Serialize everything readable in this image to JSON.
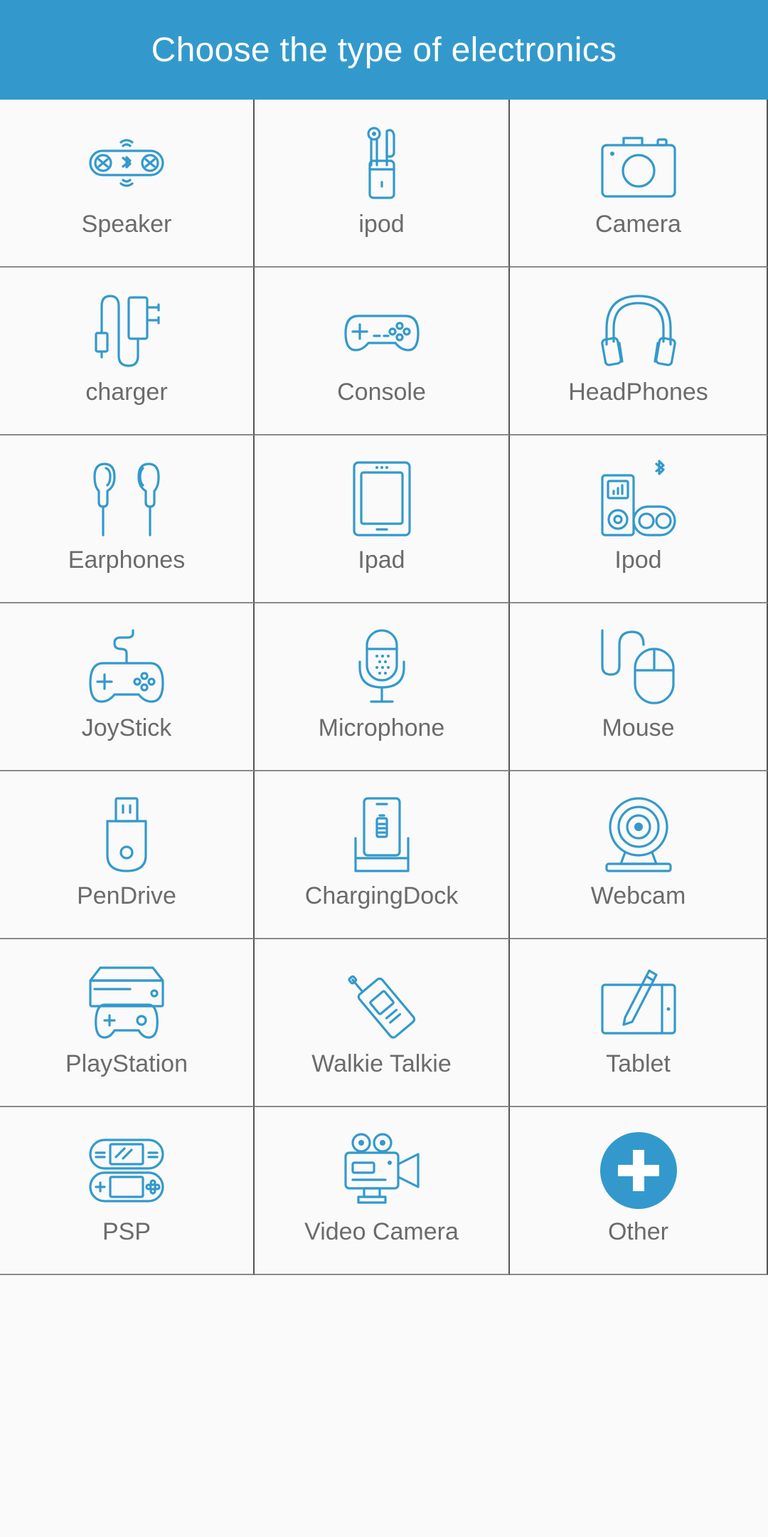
{
  "header": {
    "title": "Choose the type of electronics"
  },
  "colors": {
    "accent": "#3399cc",
    "label": "#6b6b6b",
    "background": "#fafafa"
  },
  "items": [
    {
      "label": "Speaker",
      "icon": "speaker-icon"
    },
    {
      "label": "ipod",
      "icon": "earbuds-case-icon"
    },
    {
      "label": "Camera",
      "icon": "camera-icon"
    },
    {
      "label": "charger",
      "icon": "charger-icon"
    },
    {
      "label": "Console",
      "icon": "gamepad-icon"
    },
    {
      "label": "HeadPhones",
      "icon": "headphones-icon"
    },
    {
      "label": "Earphones",
      "icon": "earphones-icon"
    },
    {
      "label": "Ipad",
      "icon": "tablet-icon"
    },
    {
      "label": "Ipod",
      "icon": "music-player-icon"
    },
    {
      "label": "JoyStick",
      "icon": "joystick-icon"
    },
    {
      "label": "Microphone",
      "icon": "microphone-icon"
    },
    {
      "label": "Mouse",
      "icon": "mouse-icon"
    },
    {
      "label": "PenDrive",
      "icon": "pendrive-icon"
    },
    {
      "label": "ChargingDock",
      "icon": "charging-dock-icon"
    },
    {
      "label": "Webcam",
      "icon": "webcam-icon"
    },
    {
      "label": "PlayStation",
      "icon": "playstation-icon"
    },
    {
      "label": "Walkie Talkie",
      "icon": "walkie-talkie-icon"
    },
    {
      "label": "Tablet",
      "icon": "drawing-tablet-icon"
    },
    {
      "label": "PSP",
      "icon": "handheld-console-icon"
    },
    {
      "label": "Video Camera",
      "icon": "video-camera-icon"
    },
    {
      "label": "Other",
      "icon": "plus-circle-icon"
    }
  ]
}
